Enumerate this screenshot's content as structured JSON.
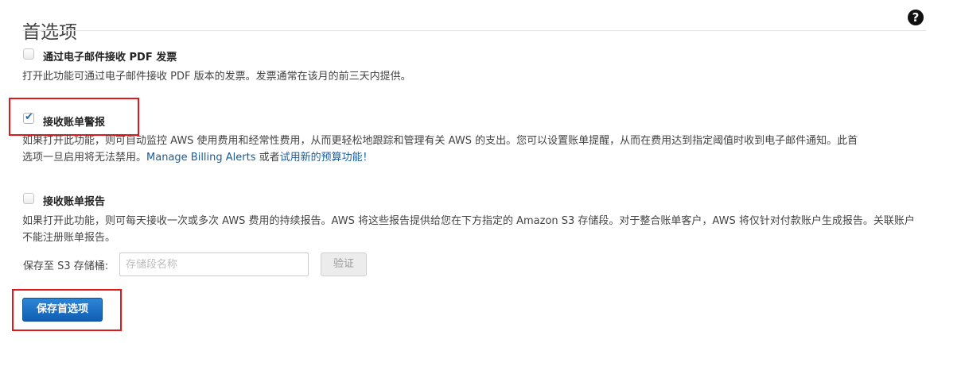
{
  "header": {
    "title": "首选项"
  },
  "icons": {
    "help": "question-circle-icon",
    "check": "checkmark-icon"
  },
  "options": [
    {
      "label": "通过电子邮件接收 PDF 发票",
      "checked": false,
      "description": "打开此功能可通过电子邮件接收 PDF 版本的发票。发票通常在该月的前三天内提供。"
    },
    {
      "label": "接收账单警报",
      "checked": true,
      "description_line1": "如果打开此功能，则可自动监控 AWS 使用费用和经常性费用，从而更轻松地跟踪和管理有关 AWS 的支出。您可以设置账单提醒，从而在费用达到指定阈值时收到电子邮件通知。此首",
      "description_line2_prefix": "选项一旦启用将无法禁用。",
      "link_manage": "Manage Billing Alerts",
      "connector": " 或者",
      "link_budget": "试用新的预算功能！"
    },
    {
      "label": "接收账单报告",
      "checked": false,
      "description": "如果打开此功能，则可每天接收一次或多次 AWS 费用的持续报告。AWS 将这些报告提供给您在下方指定的 Amazon S3 存储段。对于整合账单客户，AWS 将仅针对付款账户生成报告。关联账户不能注册账单报告。"
    }
  ],
  "bucket": {
    "label": "保存至 S3 存储桶:",
    "placeholder": "存储段名称",
    "value": "",
    "verify_label": "验证"
  },
  "save_button": {
    "label": "保存首选项"
  },
  "colors": {
    "highlight": "#e21818",
    "link": "#1a5b9a",
    "primary": "#1a6fc4"
  }
}
